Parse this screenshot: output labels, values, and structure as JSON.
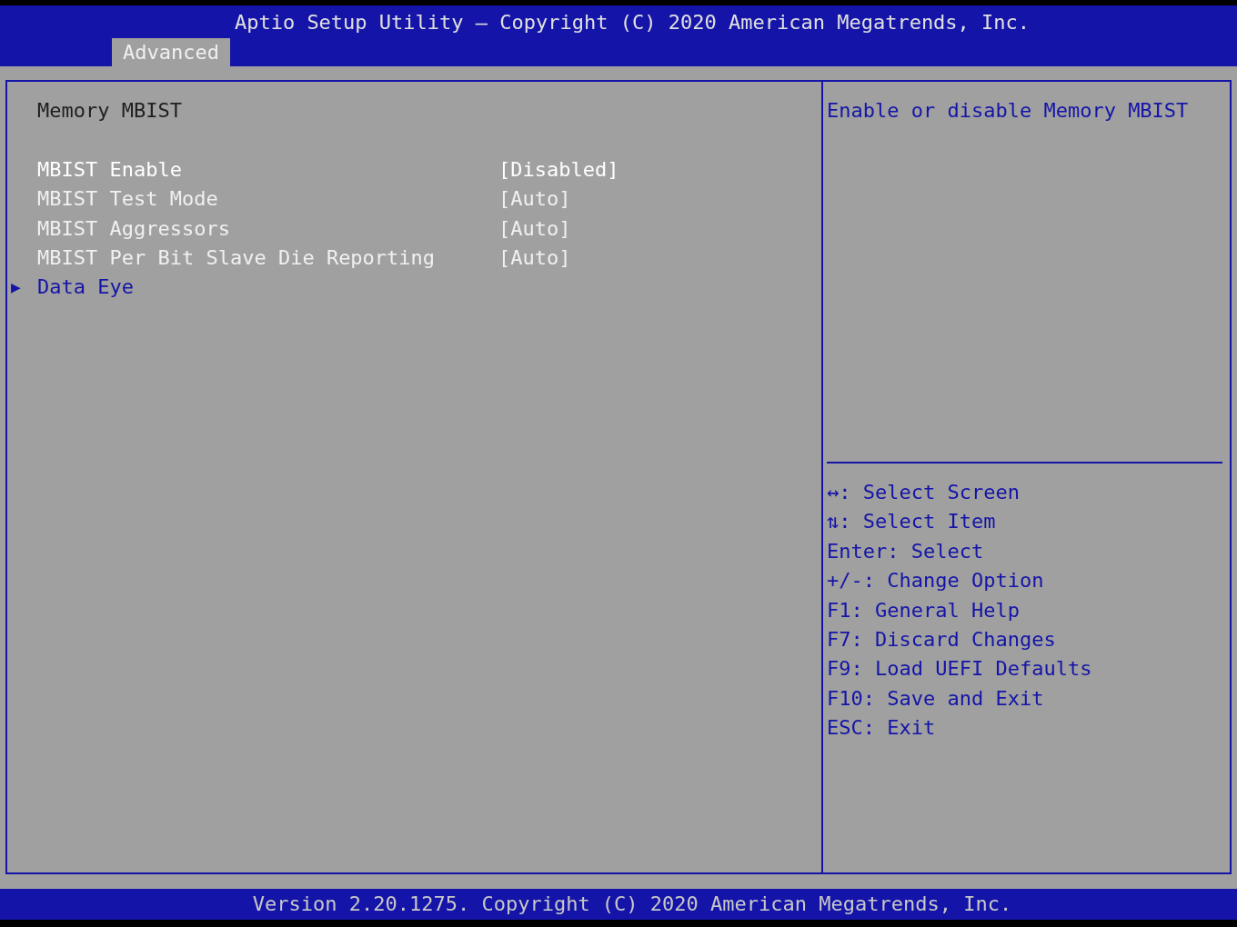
{
  "header": {
    "title": "Aptio Setup Utility – Copyright (C) 2020 American Megatrends, Inc.",
    "tabs": [
      {
        "label": "Advanced",
        "selected": true
      }
    ]
  },
  "items": [
    {
      "kind": "heading",
      "label": "Memory MBIST"
    },
    {
      "kind": "spacer"
    },
    {
      "kind": "setting",
      "label": "MBIST Enable",
      "value": "[Disabled]",
      "selected": true
    },
    {
      "kind": "setting",
      "label": "MBIST Test Mode",
      "value": "[Auto]",
      "selected": false
    },
    {
      "kind": "setting",
      "label": "MBIST Aggressors",
      "value": "[Auto]",
      "selected": false
    },
    {
      "kind": "setting",
      "label": "MBIST Per Bit Slave Die Reporting",
      "value": "[Auto]",
      "selected": false
    },
    {
      "kind": "submenu",
      "marker": "▶",
      "label": "Data Eye",
      "selected": false
    }
  ],
  "help": "Enable or disable Memory MBIST",
  "keys": [
    "↔: Select Screen",
    "⇅: Select Item",
    "Enter: Select",
    "+/-: Change Option",
    "F1: General Help",
    "F7: Discard Changes",
    "F9: Load UEFI Defaults",
    "F10: Save and Exit",
    "ESC: Exit"
  ],
  "footer": "Version 2.20.1275. Copyright (C) 2020 American Megatrends, Inc."
}
